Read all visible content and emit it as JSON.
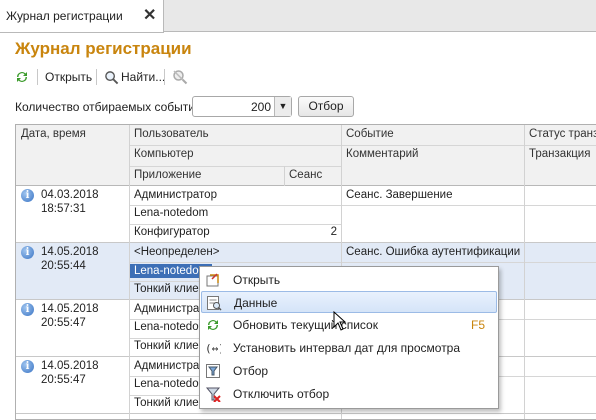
{
  "tab": {
    "title": "Журнал регистрации",
    "close": "✕"
  },
  "page": {
    "title": "Журнал регистрации"
  },
  "toolbar": {
    "open": "Открыть",
    "find": "Найти..."
  },
  "count": {
    "label": "Количество отбираемых событий:",
    "value": "200",
    "filter_button": "Отбор"
  },
  "columns": {
    "date": "Дата, время",
    "user": "Пользователь",
    "computer": "Компьютер",
    "application": "Приложение",
    "session": "Сеанс",
    "event": "Событие",
    "comment": "Комментарий",
    "status": "Статус транза",
    "transaction": "Транзакция"
  },
  "rows": [
    {
      "date": "04.03.2018",
      "time": "18:57:31",
      "user": "Администратор",
      "computer": "Lena-notedom",
      "app": "Конфигуратор",
      "session": "2",
      "event": "Сеанс. Завершение"
    },
    {
      "date": "14.05.2018",
      "time": "20:55:44",
      "user": "<Неопределен>",
      "computer": "Lena-notedom",
      "app": "Тонкий клиент",
      "session": "",
      "event": "Сеанс. Ошибка аутентификации"
    },
    {
      "date": "14.05.2018",
      "time": "20:55:47",
      "user": "Администратор",
      "computer": "Lena-notedom",
      "app": "Тонкий клиент",
      "session": "",
      "event": ""
    },
    {
      "date": "14.05.2018",
      "time": "20:55:47",
      "user": "Администратор",
      "computer": "Lena-notedom",
      "app": "Тонкий клиент",
      "session": "",
      "event": ""
    }
  ],
  "context_menu": [
    {
      "label": "Открыть",
      "icon": "open-icon",
      "shortcut": ""
    },
    {
      "label": "Данные",
      "icon": "data-icon",
      "shortcut": ""
    },
    {
      "label": "Обновить текущий список",
      "icon": "refresh-icon",
      "shortcut": "F5"
    },
    {
      "label": "Установить интервал дат для просмотра",
      "icon": "date-interval-icon",
      "shortcut": ""
    },
    {
      "label": "Отбор",
      "icon": "filter-icon",
      "shortcut": ""
    },
    {
      "label": "Отключить отбор",
      "icon": "filter-off-icon",
      "shortcut": ""
    }
  ],
  "colors": {
    "accent": "#c9850e",
    "selection": "#e2eaf6",
    "menu_hover": "#d5e4f8"
  }
}
